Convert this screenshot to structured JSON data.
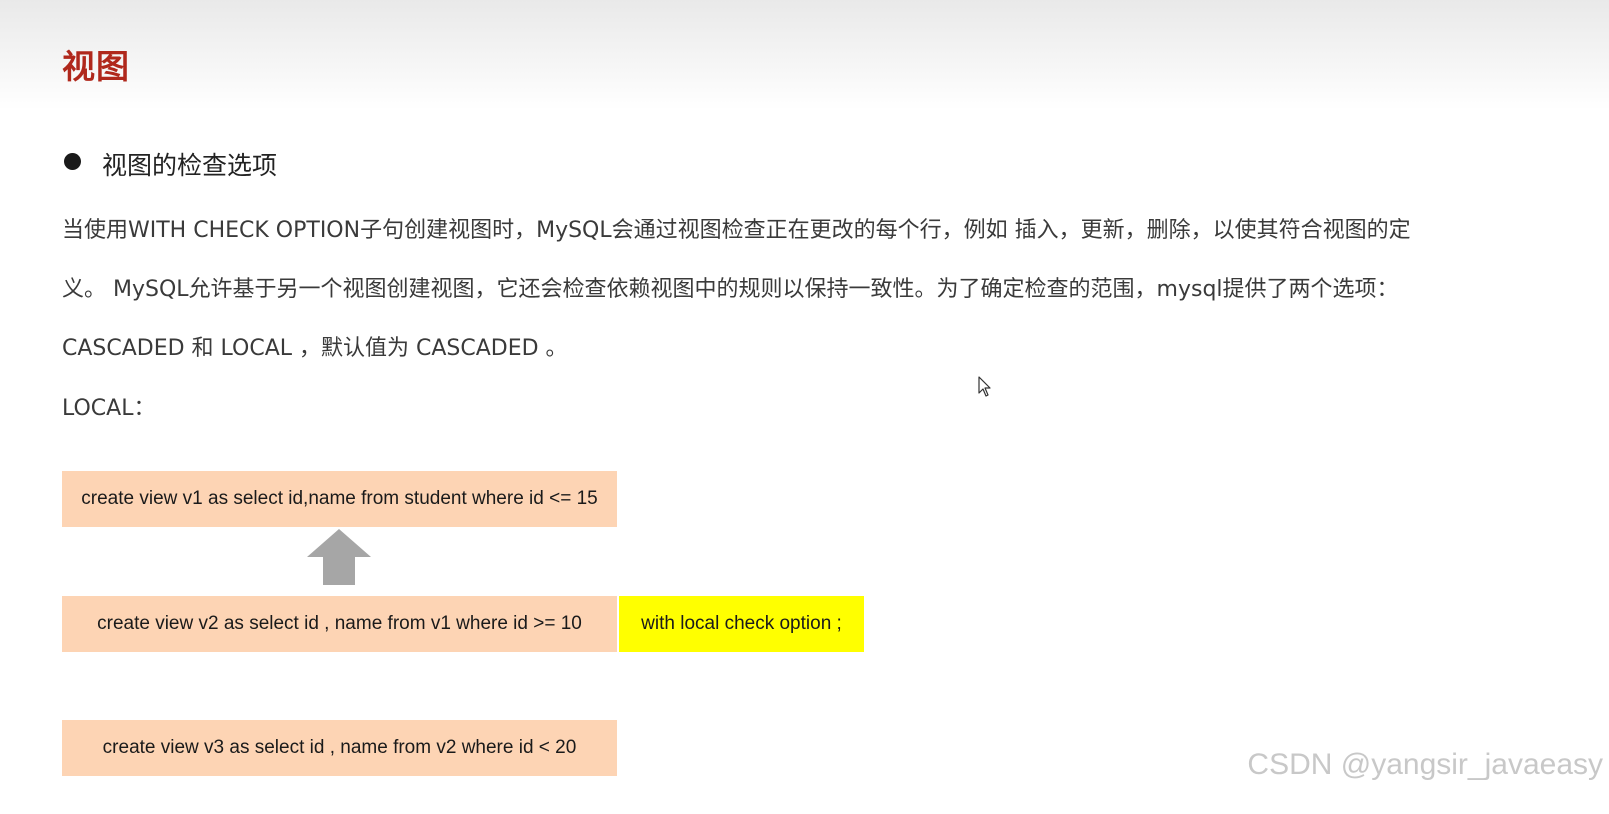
{
  "slide": {
    "title": "视图"
  },
  "section": {
    "bullet_heading": "视图的检查选项",
    "paragraph_lines": [
      "当使用WITH CHECK OPTION子句创建视图时，MySQL会通过视图检查正在更改的每个行，例如 插入，更新，删除，以使其符合视图的定",
      "义。 MySQL允许基于另一个视图创建视图，它还会检查依赖视图中的规则以保持一致性。为了确定检查的范围，mysql提供了两个选项：",
      "CASCADED 和 LOCAL ，默认值为 CASCADED 。"
    ],
    "local_label": "LOCAL："
  },
  "diagram": {
    "view_v1_sql": "create view v1 as select id,name from student where id <= 15",
    "view_v2_sql": "create view v2 as select id , name from v1 where id >= 10",
    "view_v2_option": "with local check option ;",
    "view_v3_sql": "create view v3 as select id , name from v2 where id  < 20",
    "arrow_icon": "up-arrow-icon",
    "colors": {
      "code_box": "#fdd4b4",
      "option_highlight": "#ffff00",
      "arrow": "#a6a6a6",
      "title": "#b0281c"
    }
  },
  "watermark": {
    "text": "CSDN @yangsir_javaeasy"
  }
}
